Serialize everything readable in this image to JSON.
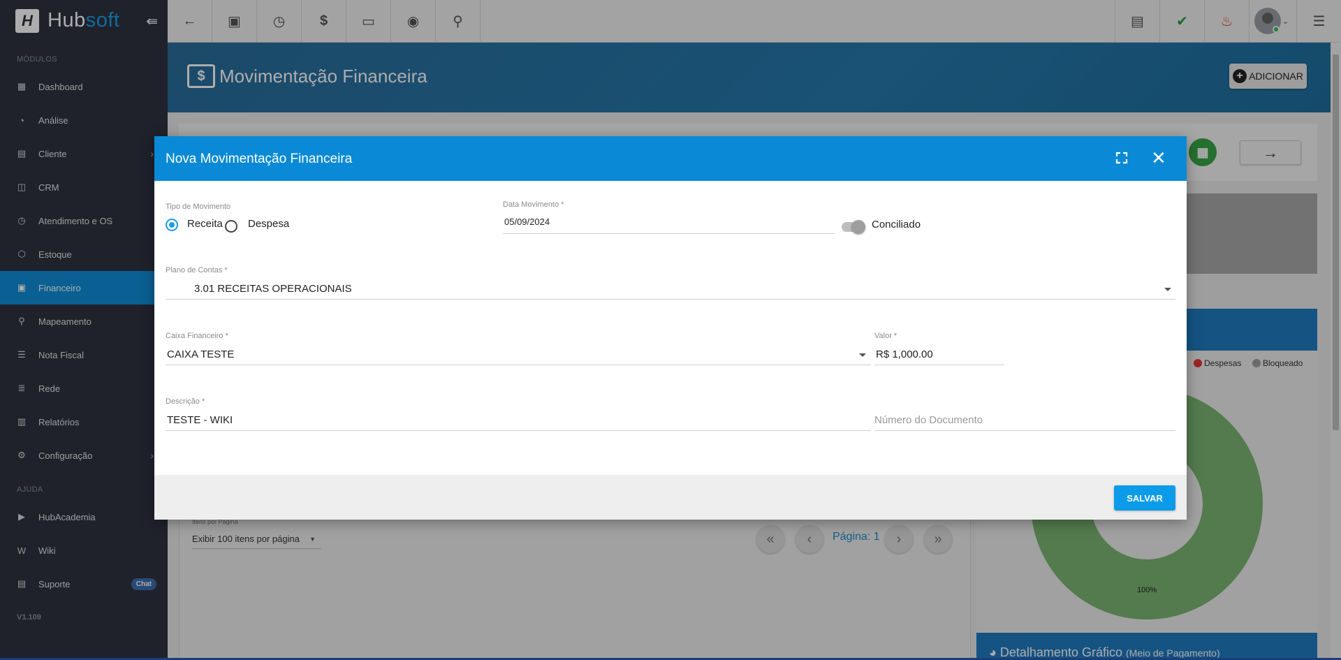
{
  "sidebar": {
    "brand_hub": "Hub",
    "brand_soft": "soft",
    "section_modules": "MÓDULOS",
    "section_help": "AJUDA",
    "items": [
      {
        "label": "Dashboard"
      },
      {
        "label": "Análise"
      },
      {
        "label": "Cliente"
      },
      {
        "label": "CRM"
      },
      {
        "label": "Atendimento e OS"
      },
      {
        "label": "Estoque"
      },
      {
        "label": "Financeiro"
      },
      {
        "label": "Mapeamento"
      },
      {
        "label": "Nota Fiscal"
      },
      {
        "label": "Rede"
      },
      {
        "label": "Relatórios"
      },
      {
        "label": "Configuração"
      }
    ],
    "help_items": [
      {
        "label": "HubAcademia"
      },
      {
        "label": "Wiki"
      },
      {
        "label": "Suporte"
      }
    ],
    "chat_badge": "Chat",
    "version": "V1.109",
    "active_item": "Financeiro"
  },
  "page": {
    "title": "Movimentação Financeira",
    "add_button": "ADICIONAR",
    "items_per_page_label": "Itens por Página",
    "items_per_page_value": "Exibir 100 itens por página",
    "page_label": "Página: 1",
    "legend": [
      {
        "label": "Despesas",
        "color": "#e53935"
      },
      {
        "label": "Bloqueado",
        "color": "#9e9e9e"
      }
    ],
    "chart_percent_label": "100%",
    "bottom_card_title": "Detalhamento Gráfico",
    "bottom_card_subtitle": "(Meio de Pagamento)"
  },
  "modal": {
    "title": "Nova Movimentação Financeira",
    "tipo_label": "Tipo de Movimento",
    "option_receita": "Receita",
    "option_despesa": "Despesa",
    "selected_option": "Receita",
    "data_label": "Data Movimento *",
    "data_value": "05/09/2024",
    "conciliado_label": "Conciliado",
    "conciliado_on": false,
    "plano_label": "Plano de Contas *",
    "plano_value": "3.01 RECEITAS OPERACIONAIS",
    "caixa_label": "Caixa Financeiro *",
    "caixa_value": "CAIXA TESTE",
    "valor_label": "Valor *",
    "valor_value": "R$ 1,000.00",
    "descricao_label": "Descrição *",
    "descricao_value": "TESTE - WIKI",
    "numero_placeholder": "Número do Documento",
    "save_button": "SALVAR"
  },
  "colors": {
    "accent": "#0a8ad6",
    "sidebar_bg": "#2e3340",
    "donut_green": "#7bb672"
  }
}
